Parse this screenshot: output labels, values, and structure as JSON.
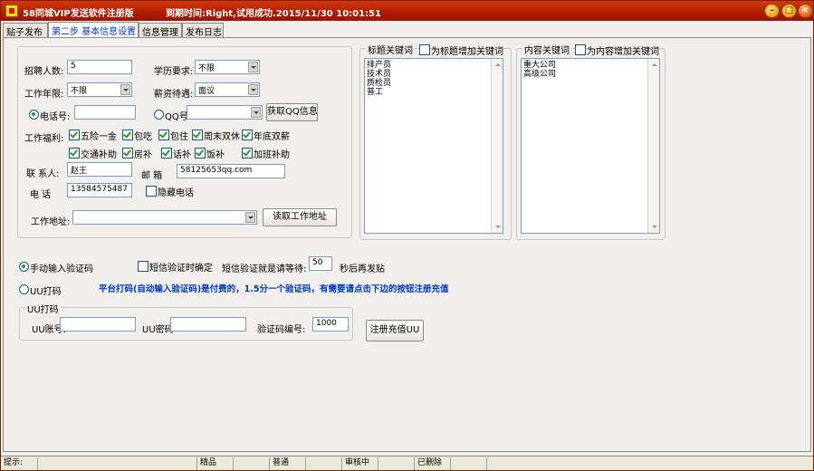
{
  "window": {
    "title": "58同城VIP发送软件注册版",
    "status": "到期时间:Right,试用成功.2015/11/30 10:01:51"
  },
  "tabs": [
    "贴子发布",
    "第二步 基本信息设置",
    "信息管理",
    "发布日志"
  ],
  "form": {
    "recruit_count_label": "招聘人数:",
    "recruit_count_value": "5",
    "education_label": "学历要求:",
    "education_value": "不限",
    "work_years_label": "工作年限:",
    "work_years_value": "不限",
    "salary_label": "薪资待遇:",
    "salary_value": "面议",
    "phone_radio_label": "电话号:",
    "qq_radio_label": "QQ号:",
    "get_qq_button": "获取QQ信息",
    "benefits_label": "工作福利:",
    "benefits": [
      {
        "label": "五险一金",
        "checked": true
      },
      {
        "label": "包吃",
        "checked": true
      },
      {
        "label": "包住",
        "checked": true
      },
      {
        "label": "周末双休",
        "checked": true
      },
      {
        "label": "年底双薪",
        "checked": true
      },
      {
        "label": "交通补助",
        "checked": true
      },
      {
        "label": "房补",
        "checked": true
      },
      {
        "label": "话补",
        "checked": true
      },
      {
        "label": "饭补",
        "checked": true
      },
      {
        "label": "加班补助",
        "checked": true
      }
    ],
    "contact_label": "联 系人:",
    "contact_value": "赵王",
    "email_label": "邮  箱",
    "email_value": "58125653qq.com",
    "tel_label": "电  话",
    "tel_value": "13584575487",
    "hide_phone_label": "隐藏电话",
    "work_addr_label": "工作地址:",
    "read_addr_button": "读取工作地址"
  },
  "title_keywords": {
    "legend": "标题关键词",
    "add_checkbox": "为标题增加关键词",
    "items": [
      "排产员",
      "技术员",
      "质检员",
      "普工"
    ]
  },
  "content_keywords": {
    "legend": "内容关键词",
    "add_checkbox": "为内容增加关键词",
    "items": [
      "重大公司",
      "高级公司"
    ]
  },
  "captcha": {
    "manual_label": "手动输入验证码",
    "sms_label": "短信验证时确定",
    "sms_wait_label": "短信验证就是请等待:",
    "sms_wait_value": "50",
    "sms_wait_suffix": "秒后再发贴",
    "uu_radio_label": "UU打码",
    "notice": "平台打码(自动输入验证码)是付费的，1.5分一个验证码，有需要请点击下边的按钮注册充值",
    "uu_group_legend": "UU打码",
    "uu_account_label": "UU账号:",
    "uu_password_label": "UU密码",
    "captcha_id_label": "验证码编号:",
    "captcha_id_value": "1000",
    "register_button": "注册充值UU"
  },
  "statusbar": [
    "提示:",
    "精品",
    "普通",
    "审核中",
    "已删除"
  ]
}
